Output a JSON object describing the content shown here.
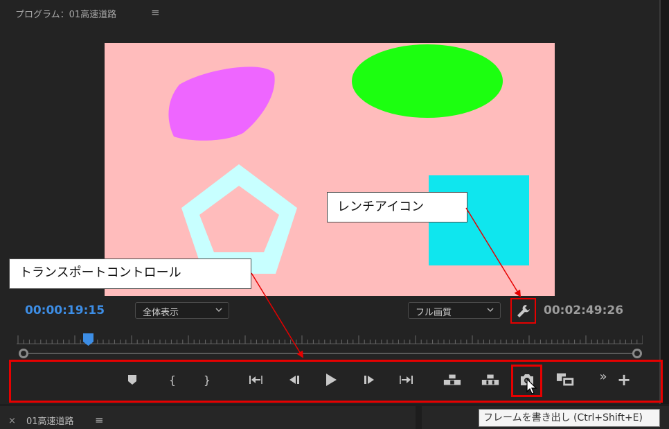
{
  "program_panel": {
    "title": "プログラム：01高速道路",
    "menu_icon": "≡"
  },
  "viewer": {
    "background": "#ffbcbc",
    "shapes": [
      {
        "kind": "blob",
        "color": "#ee66ff"
      },
      {
        "kind": "ellipse",
        "color": "#1cff10"
      },
      {
        "kind": "pentagon",
        "color": "#c8ffff"
      },
      {
        "kind": "square",
        "color": "#0fe6ee"
      }
    ]
  },
  "controls": {
    "current_timecode": "00:00:19:15",
    "duration_timecode": "00:02:49:26",
    "zoom_select": "全体表示",
    "quality_select": "フル画質",
    "chevron_icon": "chevron-down-icon",
    "wrench_icon": "wrench-icon"
  },
  "transport": {
    "buttons": [
      {
        "name": "add-marker-button",
        "icon": "marker-icon"
      },
      {
        "name": "mark-in-button",
        "icon": "mark-in-icon",
        "glyph": "{"
      },
      {
        "name": "mark-out-button",
        "icon": "mark-out-icon",
        "glyph": "}"
      },
      {
        "name": "go-to-in-button",
        "icon": "go-to-in-icon"
      },
      {
        "name": "step-back-button",
        "icon": "step-back-icon"
      },
      {
        "name": "play-button",
        "icon": "play-icon"
      },
      {
        "name": "step-forward-button",
        "icon": "step-forward-icon"
      },
      {
        "name": "go-to-out-button",
        "icon": "go-to-out-icon"
      },
      {
        "name": "lift-button",
        "icon": "lift-icon"
      },
      {
        "name": "extract-button",
        "icon": "extract-icon"
      },
      {
        "name": "export-frame-button",
        "icon": "camera-icon"
      },
      {
        "name": "comparison-view-button",
        "icon": "comparison-icon"
      },
      {
        "name": "overflow-button",
        "icon": "double-chevron-icon",
        "glyph": "»"
      },
      {
        "name": "button-editor-button",
        "icon": "plus-icon",
        "glyph": "+"
      }
    ]
  },
  "callouts": {
    "wrench": "レンチアイコン",
    "transport": "トランスポートコントロール"
  },
  "tooltip": "フレームを書き出し (Ctrl+Shift+E)",
  "timeline_tab": {
    "close": "×",
    "label": "01高速道路",
    "menu_icon": "≡"
  },
  "colors": {
    "accent_blue": "#3d8ee6",
    "highlight_red": "#e60000"
  }
}
